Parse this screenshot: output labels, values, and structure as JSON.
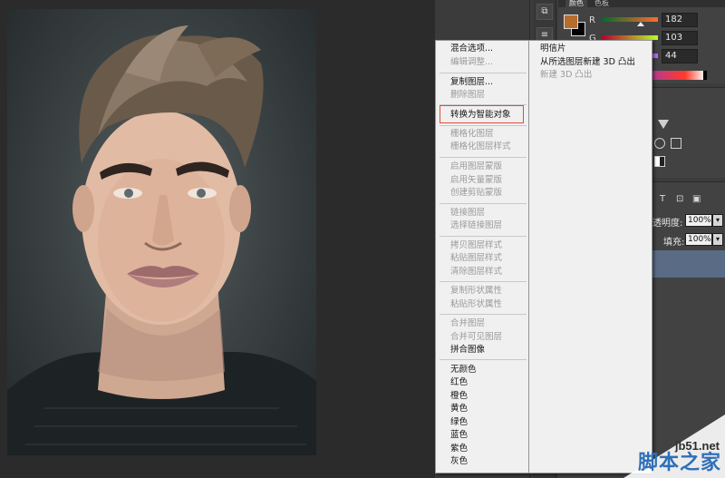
{
  "color_panel": {
    "tabs": [
      "颜色",
      "色板"
    ],
    "foreground_color": "#b66c2c",
    "channels": [
      {
        "label": "R",
        "value": "182"
      },
      {
        "label": "G",
        "value": "103"
      },
      {
        "label": "B",
        "value": "44"
      }
    ]
  },
  "layers_panel": {
    "opacity_label": "透明度:",
    "opacity_value": "100%",
    "fill_label": "填充:",
    "fill_value": "100%",
    "type_icon": "T"
  },
  "context_menu": {
    "items": [
      {
        "label": "混合选项...",
        "enabled": true
      },
      {
        "label": "编辑调整...",
        "enabled": false
      },
      {
        "label": "复制图层...",
        "enabled": true
      },
      {
        "label": "删除图层",
        "enabled": false
      },
      {
        "label": "转换为智能对象",
        "enabled": true,
        "highlighted": true
      },
      {
        "label": "栅格化图层",
        "enabled": false
      },
      {
        "label": "栅格化图层样式",
        "enabled": false
      },
      {
        "label": "启用图层蒙版",
        "enabled": false
      },
      {
        "label": "启用矢量蒙版",
        "enabled": false
      },
      {
        "label": "创建剪贴蒙版",
        "enabled": false
      },
      {
        "label": "链接图层",
        "enabled": false
      },
      {
        "label": "选择链接图层",
        "enabled": false
      },
      {
        "label": "拷贝图层样式",
        "enabled": false
      },
      {
        "label": "粘贴图层样式",
        "enabled": false
      },
      {
        "label": "清除图层样式",
        "enabled": false
      },
      {
        "label": "复制形状属性",
        "enabled": false
      },
      {
        "label": "粘贴形状属性",
        "enabled": false
      },
      {
        "label": "合并图层",
        "enabled": false
      },
      {
        "label": "合并可见图层",
        "enabled": false
      },
      {
        "label": "拼合图像",
        "enabled": true
      },
      {
        "label": "无颜色",
        "enabled": true
      },
      {
        "label": "红色",
        "enabled": true
      },
      {
        "label": "橙色",
        "enabled": true
      },
      {
        "label": "黄色",
        "enabled": true
      },
      {
        "label": "绿色",
        "enabled": true
      },
      {
        "label": "蓝色",
        "enabled": true
      },
      {
        "label": "紫色",
        "enabled": true
      },
      {
        "label": "灰色",
        "enabled": true
      }
    ],
    "submenu": [
      {
        "label": "明信片",
        "enabled": true
      },
      {
        "label": "从所选图层新建 3D 凸出",
        "enabled": true
      },
      {
        "label": "新建 3D 凸出",
        "enabled": false
      }
    ]
  },
  "watermark": {
    "url": "jb51.net",
    "text": "脚本之家"
  }
}
